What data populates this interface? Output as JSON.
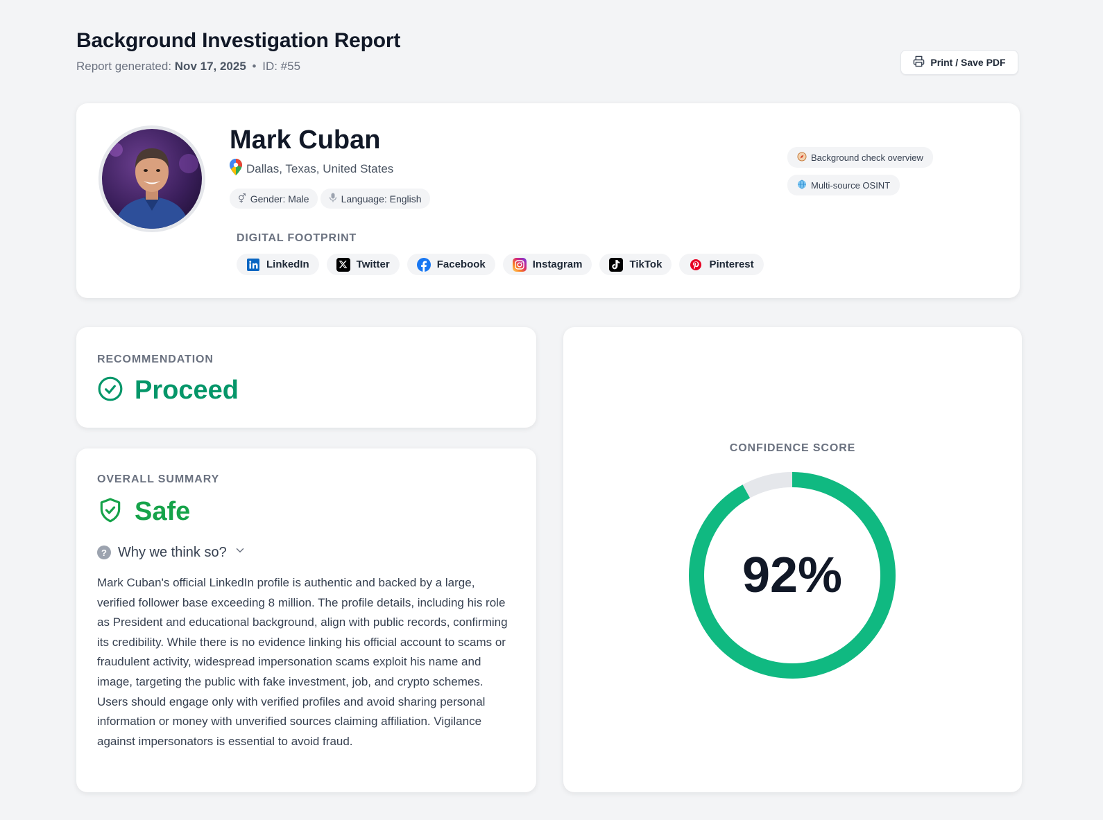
{
  "header": {
    "title": "Background Investigation Report",
    "generated_label": "Report generated:",
    "generated_date": "Nov 17, 2025",
    "separator": "•",
    "id_label": "ID: #55",
    "print_label": "Print / Save PDF"
  },
  "profile": {
    "name": "Mark Cuban",
    "location": "Dallas, Texas, United States",
    "chips": [
      {
        "icon": "gender-icon",
        "label": "Gender: Male"
      },
      {
        "icon": "microphone-icon",
        "label": "Language: English"
      }
    ],
    "digital_footprint_label": "DIGITAL FOOTPRINT",
    "socials": [
      {
        "icon": "linkedin-icon",
        "label": "LinkedIn",
        "color": "#0a66c2"
      },
      {
        "icon": "x-twitter-icon",
        "label": "Twitter",
        "color": "#000000"
      },
      {
        "icon": "facebook-icon",
        "label": "Facebook",
        "color": "#1877f2"
      },
      {
        "icon": "instagram-icon",
        "label": "Instagram",
        "color": "#e1306c"
      },
      {
        "icon": "tiktok-icon",
        "label": "TikTok",
        "color": "#000000"
      },
      {
        "icon": "pinterest-icon",
        "label": "Pinterest",
        "color": "#e60023"
      }
    ],
    "tags": [
      {
        "icon": "compass-icon",
        "label": "Background check overview"
      },
      {
        "icon": "globe-icon",
        "label": "Multi-source OSINT"
      }
    ]
  },
  "recommendation": {
    "label": "RECOMMENDATION",
    "value": "Proceed",
    "color": "#059669"
  },
  "summary": {
    "label": "OVERALL SUMMARY",
    "value": "Safe",
    "color": "#16a34a",
    "why_label": "Why we think so?",
    "text": "Mark Cuban's official LinkedIn profile is authentic and backed by a large, verified follower base exceeding 8 million. The profile details, including his role as President and educational background, align with public records, confirming its credibility. While there is no evidence linking his official account to scams or fraudulent activity, widespread impersonation scams exploit his name and image, targeting the public with fake investment, job, and crypto schemes. Users should engage only with verified profiles and avoid sharing personal information or money with unverified sources claiming affiliation. Vigilance against impersonators is essential to avoid fraud."
  },
  "confidence": {
    "label": "CONFIDENCE SCORE",
    "value_text": "92%",
    "fraction": 0.92,
    "color": "#10b981",
    "track_color": "#e5e7eb"
  }
}
